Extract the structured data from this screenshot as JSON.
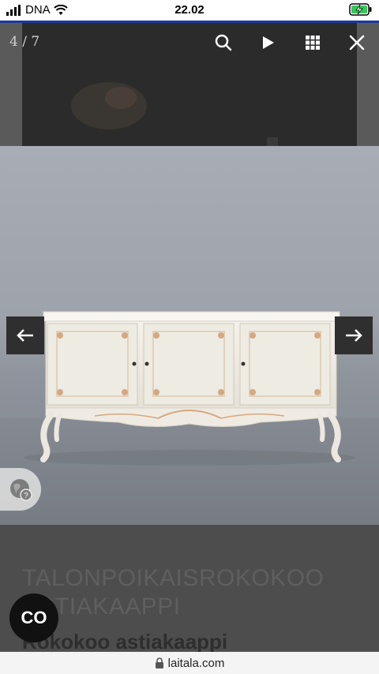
{
  "status_bar": {
    "carrier": "DNA",
    "time": "22.02"
  },
  "gallery": {
    "counter": "4 / 7",
    "icons": [
      "search-icon",
      "play-icon",
      "grid-icon",
      "close-icon"
    ],
    "nav": [
      "arrow-left-icon",
      "arrow-right-icon"
    ]
  },
  "page": {
    "title": "TALONPOIKAISROKOKOO ASTIAKAAPPI",
    "subtitle": "Rokokoo astiakaappi",
    "chat_button_label": "CO"
  },
  "browser": {
    "url": "laitala.com"
  },
  "colors": {
    "status_blue": "#1a3b9a",
    "overlay_dark": "#2f2f2f",
    "battery_green": "#34c759"
  }
}
